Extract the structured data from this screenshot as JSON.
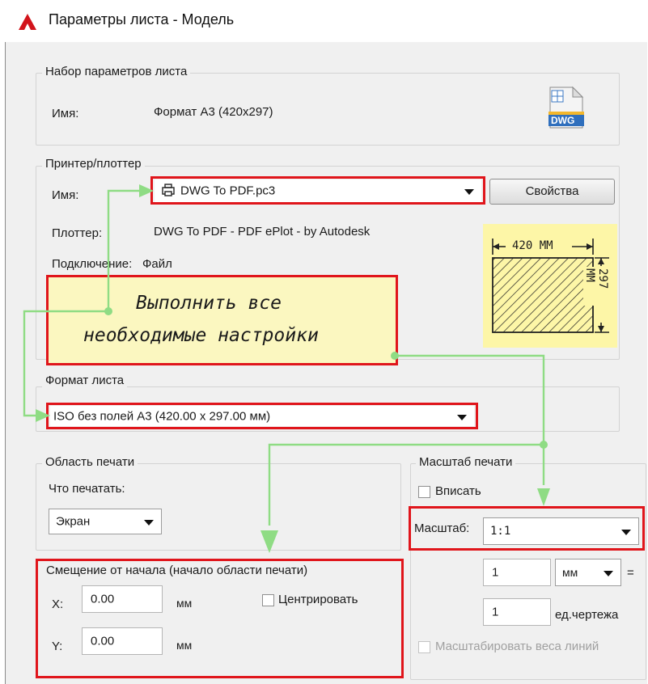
{
  "window": {
    "title": "Параметры листа - Модель",
    "logo_icon": "autocad-logo-icon"
  },
  "page_setup": {
    "legend": "Набор параметров листа",
    "name_label": "Имя:",
    "name_value": "Формат А3 (420x297)",
    "file_icon_text": "DWG"
  },
  "printer": {
    "legend": "Принтер/плоттер",
    "name_label": "Имя:",
    "selected": "DWG To PDF.pc3",
    "properties_button": "Свойства",
    "plotter_label": "Плоттер:",
    "plotter_value": "DWG To PDF - PDF ePlot - by Autodesk",
    "connection_label": "Подключение:",
    "connection_value": "Файл",
    "preview": {
      "width_text": "420 ММ",
      "height_text": "297 ММ"
    }
  },
  "annotation": {
    "line1": "Выполнить все",
    "line2": "необходимые настройки"
  },
  "paper_size": {
    "legend": "Формат листа",
    "selected": "ISO без полей А3 (420.00 x 297.00 мм)"
  },
  "plot_area": {
    "legend": "Область печати",
    "what_label": "Что печатать:",
    "selected": "Экран"
  },
  "offset": {
    "legend": "Смещение от начала (начало области печати)",
    "x_label": "X:",
    "x_value": "0.00",
    "x_unit": "мм",
    "y_label": "Y:",
    "y_value": "0.00",
    "y_unit": "мм",
    "center_label": "Центрировать"
  },
  "plot_scale": {
    "legend": "Масштаб печати",
    "fit_label": "Вписать",
    "scale_label": "Масштаб:",
    "scale_value": "1:1",
    "value1": "1",
    "unit_selected": "мм",
    "equals": "=",
    "value2": "1",
    "drawing_units_label": "ед.чертежа",
    "lineweights_label": "Масштабировать веса линий"
  },
  "colors": {
    "accent_red": "#e0151b",
    "arrow_green": "#8fdc84",
    "note_bg": "#fbf7c0",
    "preview_bg": "#fdf6a7"
  }
}
